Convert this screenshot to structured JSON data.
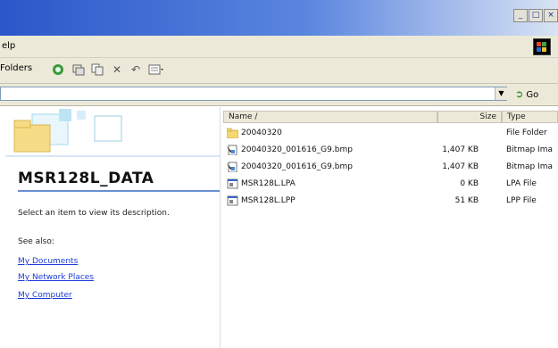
{
  "window": {
    "controls": [
      "_",
      "□",
      "×"
    ]
  },
  "menubar": {
    "help_label": "elp"
  },
  "toolbar": {
    "folders_label": "Folders"
  },
  "addressbar": {
    "value": "",
    "go_label": "Go"
  },
  "leftpane": {
    "title": "MSR128L_DATA",
    "description": "Select an item to view its description.",
    "see_also": "See also:",
    "links": [
      "My Documents",
      "My Network Places",
      "My Computer"
    ]
  },
  "filelist": {
    "columns": {
      "name": "Name  ∕",
      "size": "Size",
      "type": "Type"
    },
    "rows": [
      {
        "name": "20040320",
        "size": "",
        "type": "File Folder",
        "icon": "folder-icon"
      },
      {
        "name": "20040320_001616_G9.bmp",
        "size": "1,407 KB",
        "type": "Bitmap Ima",
        "icon": "bitmap-file-icon"
      },
      {
        "name": "20040320_001616_G9.bmp",
        "size": "1,407 KB",
        "type": "Bitmap Ima",
        "icon": "bitmap-file-icon"
      },
      {
        "name": "MSR128L.LPA",
        "size": "0 KB",
        "type": "LPA File",
        "icon": "generic-file-icon"
      },
      {
        "name": "MSR128L.LPP",
        "size": "51 KB",
        "type": "LPP File",
        "icon": "generic-file-icon"
      }
    ]
  },
  "colors": {
    "title_blue": "#2a57c9",
    "link_blue": "#1a3cd8",
    "chrome_beige": "#ece9d8"
  }
}
